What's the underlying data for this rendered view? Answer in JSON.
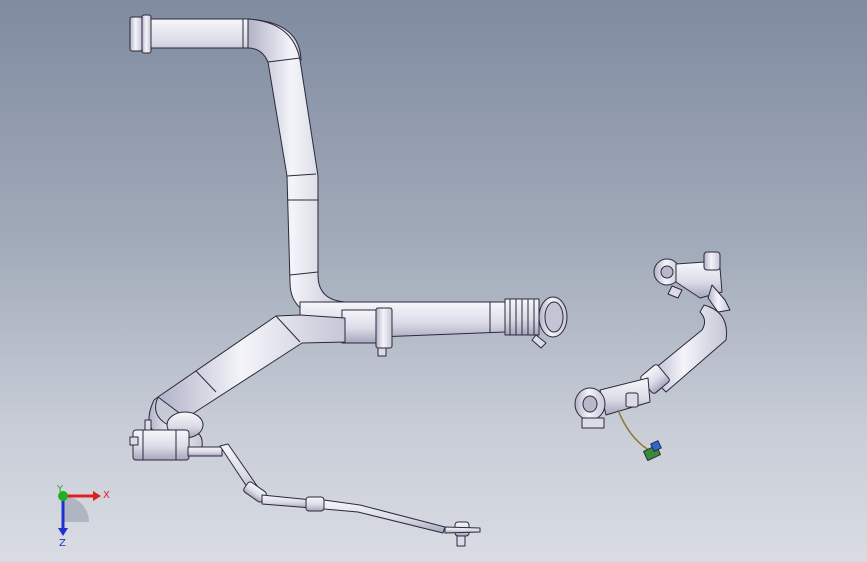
{
  "viewport": {
    "background_top": "#7f8ba0",
    "background_bottom": "#d9dce3"
  },
  "triad": {
    "x_label": "X",
    "y_label": "Y",
    "z_label": "Z",
    "x_color": "#e02020",
    "y_color": "#20b020",
    "z_color": "#2030d0"
  },
  "model": {
    "pipe_color": "#e9e9f2",
    "pipe_shadow": "#a8a8c0",
    "edge_color": "#2a2a3a"
  }
}
